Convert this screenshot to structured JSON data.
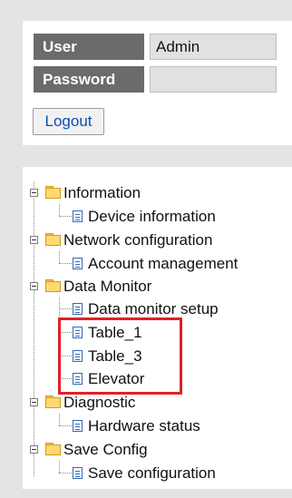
{
  "login": {
    "user_label": "User",
    "user_value": "Admin",
    "password_label": "Password",
    "password_value": "",
    "logout_label": "Logout"
  },
  "tree": {
    "information": {
      "label": "Information",
      "children": [
        "Device information"
      ]
    },
    "network": {
      "label": "Network configuration",
      "children": [
        "Account management"
      ]
    },
    "data_monitor": {
      "label": "Data Monitor",
      "children": [
        "Data monitor setup",
        "Table_1",
        "Table_3",
        "Elevator"
      ]
    },
    "diagnostic": {
      "label": "Diagnostic",
      "children": [
        "Hardware status"
      ]
    },
    "save_config": {
      "label": "Save Config",
      "children": [
        "Save configuration"
      ]
    }
  },
  "highlight": {
    "color": "#e0202a",
    "covers": [
      "Table_1",
      "Table_3",
      "Elevator"
    ]
  }
}
